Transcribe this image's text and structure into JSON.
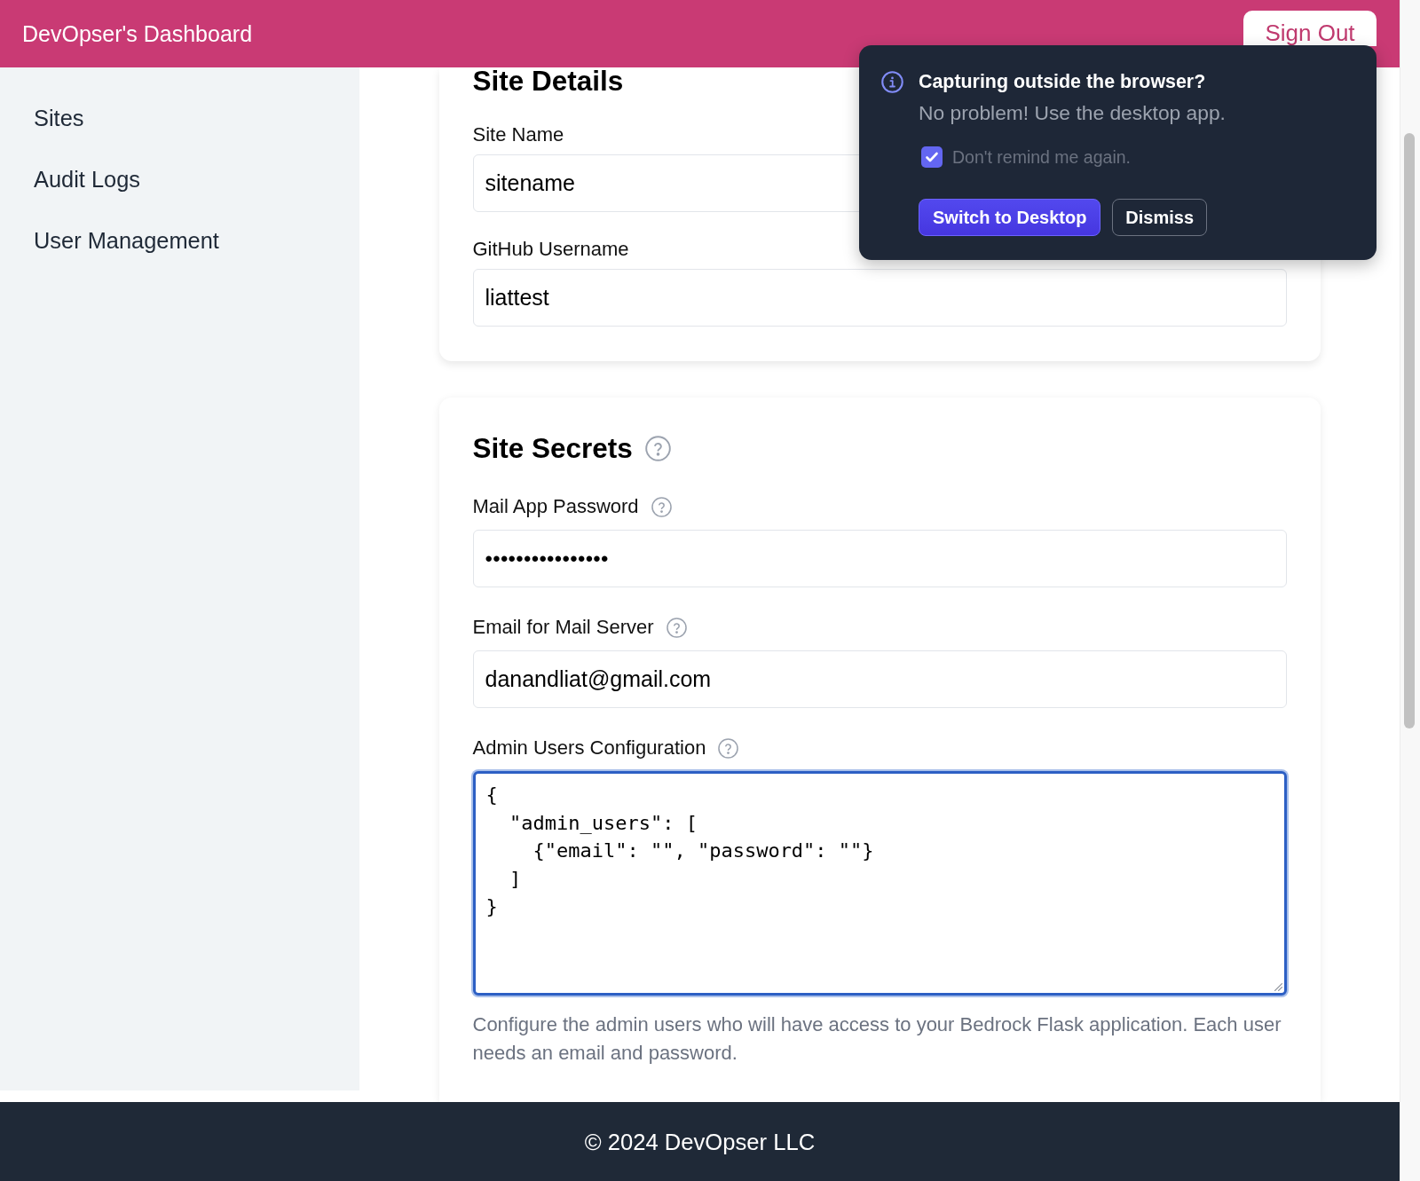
{
  "header": {
    "title": "DevOpser's Dashboard",
    "sign_out_button": "Sign Out"
  },
  "sidebar": {
    "items": [
      {
        "label": "Sites"
      },
      {
        "label": "Audit Logs"
      },
      {
        "label": "User Management"
      }
    ]
  },
  "site_details": {
    "title": "Site Details",
    "help": false,
    "fields": [
      {
        "kind": "text",
        "label": "Site Name",
        "help": false,
        "value": "sitename"
      },
      {
        "kind": "text",
        "label": "GitHub Username",
        "help": false,
        "value": "liattest"
      }
    ]
  },
  "site_secrets": {
    "title": "Site Secrets",
    "help": true,
    "fields": [
      {
        "kind": "password",
        "label": "Mail App Password",
        "help": true,
        "value": "••••••••••••••••"
      },
      {
        "kind": "text",
        "label": "Email for Mail Server",
        "help": true,
        "value": "danandliat@gmail.com"
      },
      {
        "kind": "textarea",
        "label": "Admin Users Configuration",
        "help": true,
        "focused": true,
        "value": "{\n  \"admin_users\": [\n    {\"email\": \"\", \"password\": \"\"}\n  ]\n}",
        "hint": "Configure the admin users who will have access to your Bedrock Flask application. Each user needs an email and password."
      }
    ]
  },
  "footer": {
    "text": "© 2024 DevOpser LLC"
  },
  "popup": {
    "title": "Capturing outside the browser?",
    "message": "No problem! Use the desktop app.",
    "checkbox": {
      "label": "Don't remind me again.",
      "checked": true
    },
    "buttons": [
      {
        "kind": "primary",
        "label": "Switch to Desktop"
      },
      {
        "kind": "secondary",
        "label": "Dismiss"
      }
    ]
  }
}
